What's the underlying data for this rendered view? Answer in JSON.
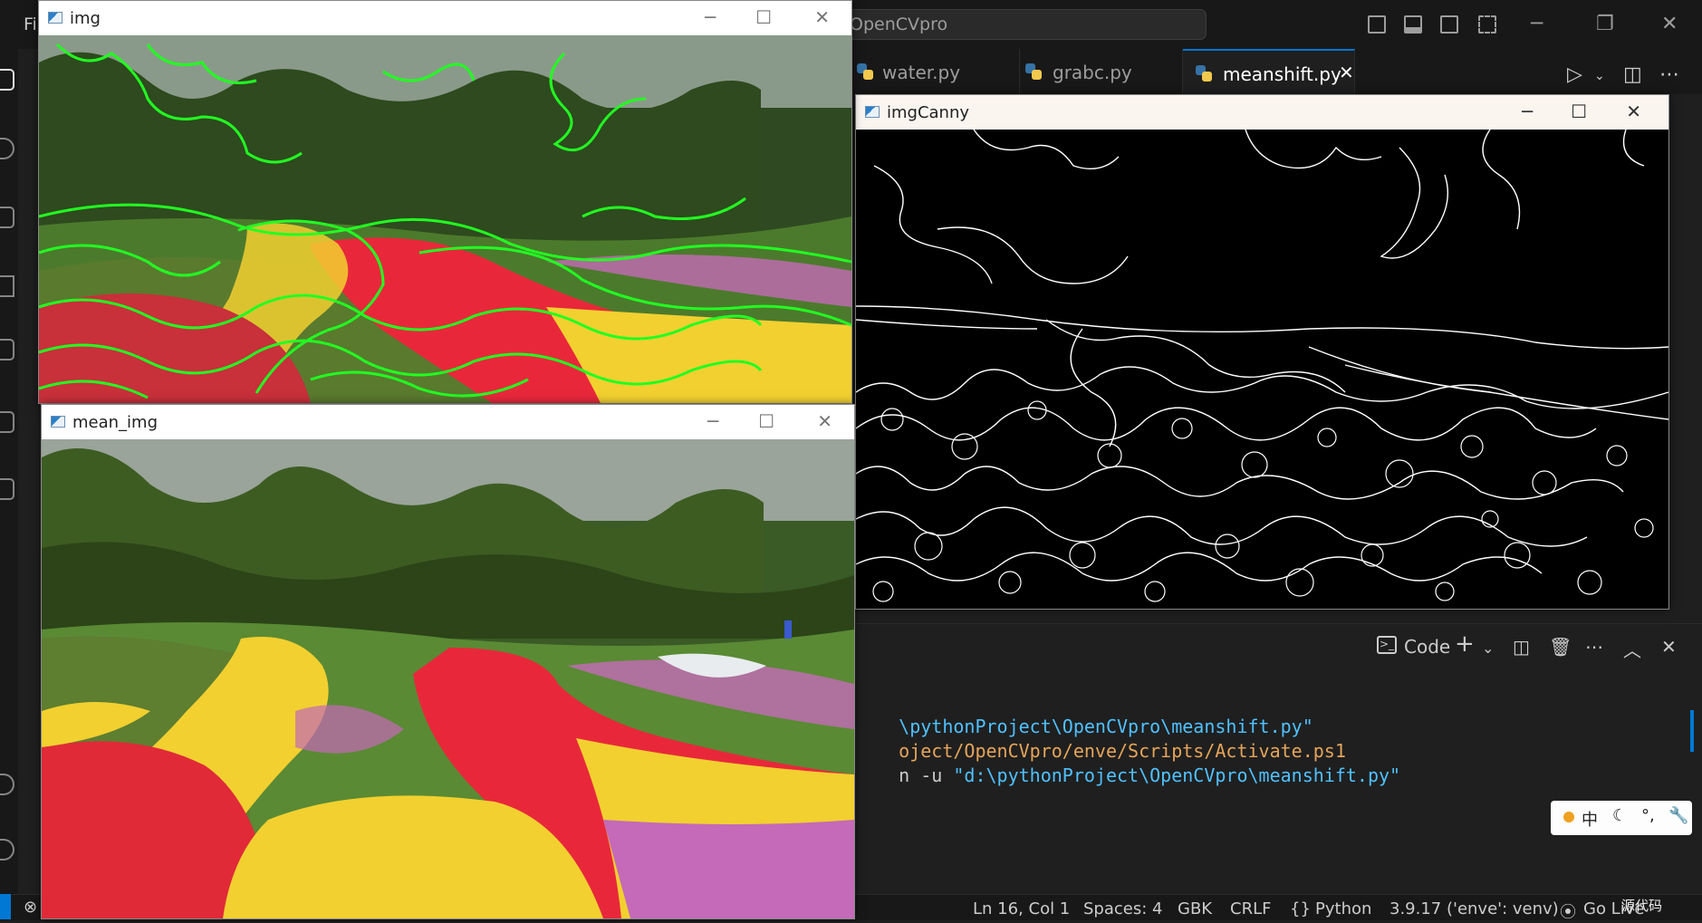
{
  "vscode": {
    "title_search": "OpenCVpro",
    "menu_fragment": "Fi",
    "tabs": [
      {
        "label": "water.py"
      },
      {
        "label": "grabc.py"
      },
      {
        "label": "meanshift.py",
        "close": "✕"
      }
    ],
    "panel": {
      "terminal_name": "Code"
    },
    "terminal_lines": [
      {
        "parts": [
          {
            "cls": "t-str",
            "text": "\\pythonProject\\OpenCVpro\\meanshift.py\""
          }
        ]
      },
      {
        "parts": [
          {
            "cls": "t-path",
            "text": "oject/OpenCVpro/enve/Scripts/Activate.ps1"
          }
        ]
      },
      {
        "parts": [
          {
            "cls": "t-plain",
            "text": "n -u "
          },
          {
            "cls": "t-str",
            "text": "\"d:\\pythonProject\\OpenCVpro\\meanshift.py\""
          }
        ]
      }
    ],
    "ime": {
      "lang": "中"
    },
    "statusbar": {
      "position": "Ln 16, Col 1",
      "spaces": "Spaces: 4",
      "encoding": "GBK",
      "eol": "CRLF",
      "language": "Python",
      "interpreter": "3.9.17 ('enve': venv)",
      "golive": "Go Live",
      "watermark": "源代码"
    }
  },
  "windows": {
    "img": {
      "title": "img"
    },
    "mean_img": {
      "title": "mean_img"
    },
    "imgCanny": {
      "title": "imgCanny"
    }
  },
  "colors": {
    "accent": "#0078d4",
    "contour_green": "#22ff22",
    "tulip_red": "#e8283a",
    "tulip_yellow": "#f2d030",
    "tulip_pink": "#c46ab8"
  }
}
